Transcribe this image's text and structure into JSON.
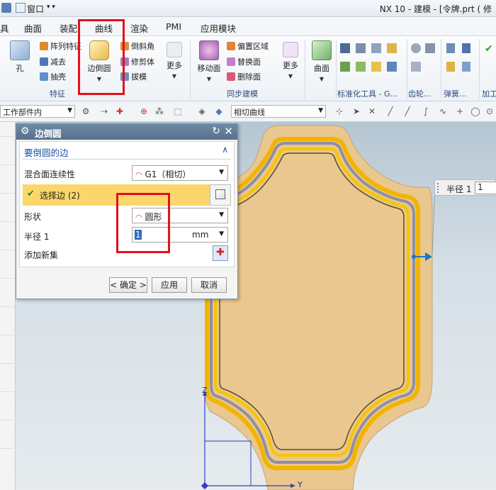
{
  "titlebar": {
    "window_menu": "窗口",
    "title": "NX 10 - 建模 - [令牌.prt  ( 修"
  },
  "menu": [
    "具",
    "曲面",
    "装配",
    "曲线",
    "渲染",
    "PMI",
    "应用模块"
  ],
  "ribbon": {
    "feature_group": {
      "hole": "孔",
      "array": "阵列特征",
      "subtract": "减去",
      "shell": "抽壳",
      "edge_blend": "边倒圆",
      "chamfer": "倒斜角",
      "trim_body": "修剪体",
      "draft": "拔模",
      "more": "更多",
      "label": "特征"
    },
    "sync_group": {
      "move_face": "移动面",
      "offset_region": "偏置区域",
      "replace_face": "替换面",
      "delete_face": "删除面",
      "more": "更多",
      "label": "同步建模"
    },
    "surface": "曲面",
    "std_tools_label": "标准化工具 - G...",
    "gear_label": "齿轮...",
    "spring_label": "弹簧...",
    "machining_label": "加工"
  },
  "selection_bar": {
    "filter": "工作部件内",
    "curve_rule": "相切曲线"
  },
  "dialog": {
    "title": "边倒圆",
    "section": "要倒圆的边",
    "continuity_label": "混合面连续性",
    "continuity_value": "G1（相切）",
    "select_edge": "选择边 (2)",
    "shape_label": "形状",
    "shape_value": "圆形",
    "radius_label": "半径 1",
    "radius_value": "1",
    "radius_unit": "mm",
    "add_set_label": "添加新集",
    "ok": "< 确定 >",
    "apply": "应用",
    "cancel": "取消"
  },
  "radius_popup": {
    "label": "半径 1",
    "value": "1"
  },
  "axes": {
    "z": "Z",
    "y": "Y"
  },
  "colors": {
    "highlight_row": "#fbd76b",
    "accent_red": "#e3101a",
    "part_fill": "#e9c78e"
  }
}
